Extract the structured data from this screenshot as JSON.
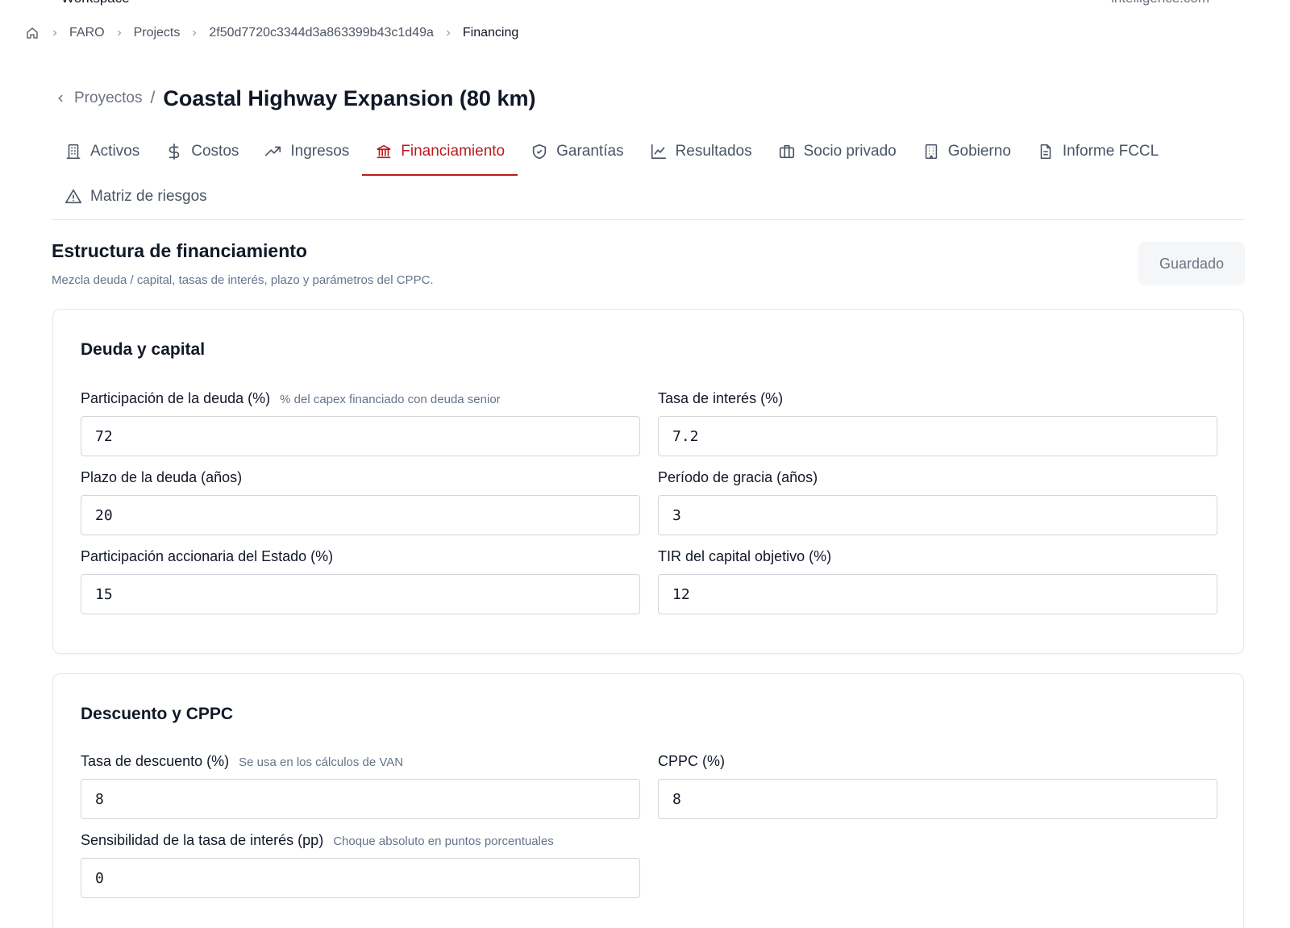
{
  "top": {
    "left_text": "Workspace",
    "right_text": "intelligence.com"
  },
  "breadcrumb": {
    "items": [
      "FARO",
      "Projects",
      "2f50d7720c3344d3a863399b43c1d49a"
    ],
    "current": "Financing"
  },
  "header": {
    "back_label": "Proyectos",
    "separator": "/",
    "title": "Coastal Highway Expansion (80 km)"
  },
  "tabs": [
    {
      "label": "Activos",
      "icon": "building-icon"
    },
    {
      "label": "Costos",
      "icon": "dollar-icon"
    },
    {
      "label": "Ingresos",
      "icon": "trending-up-icon"
    },
    {
      "label": "Financiamiento",
      "icon": "bank-icon",
      "active": true
    },
    {
      "label": "Garantías",
      "icon": "shield-icon"
    },
    {
      "label": "Resultados",
      "icon": "line-chart-icon"
    },
    {
      "label": "Socio privado",
      "icon": "briefcase-icon"
    },
    {
      "label": "Gobierno",
      "icon": "office-building-icon"
    },
    {
      "label": "Informe FCCL",
      "icon": "document-icon"
    },
    {
      "label": "Matriz de riesgos",
      "icon": "warning-icon"
    }
  ],
  "section": {
    "title": "Estructura de financiamiento",
    "subtitle": "Mezcla deuda / capital, tasas de interés, plazo y parámetros del CPPC.",
    "saved_label": "Guardado"
  },
  "debt_card": {
    "title": "Deuda y capital",
    "fields": [
      {
        "label": "Participación de la deuda (%)",
        "hint": "% del capex financiado con deuda senior",
        "value": "72"
      },
      {
        "label": "Tasa de interés (%)",
        "hint": "",
        "value": "7.2"
      },
      {
        "label": "Plazo de la deuda (años)",
        "hint": "",
        "value": "20"
      },
      {
        "label": "Período de gracia (años)",
        "hint": "",
        "value": "3"
      },
      {
        "label": "Participación accionaria del Estado (%)",
        "hint": "",
        "value": "15"
      },
      {
        "label": "TIR del capital objetivo (%)",
        "hint": "",
        "value": "12"
      }
    ]
  },
  "discount_card": {
    "title": "Descuento y CPPC",
    "fields": [
      {
        "label": "Tasa de descuento (%)",
        "hint": "Se usa en los cálculos de VAN",
        "value": "8"
      },
      {
        "label": "CPPC (%)",
        "hint": "",
        "value": "8"
      },
      {
        "label": "Sensibilidad de la tasa de interés (pp)",
        "hint": "Choque absoluto en puntos porcentuales",
        "value": "0"
      }
    ]
  },
  "colors": {
    "accent": "#b91c1c",
    "text": "#111827",
    "muted": "#64748b",
    "border": "#e5e7eb"
  }
}
